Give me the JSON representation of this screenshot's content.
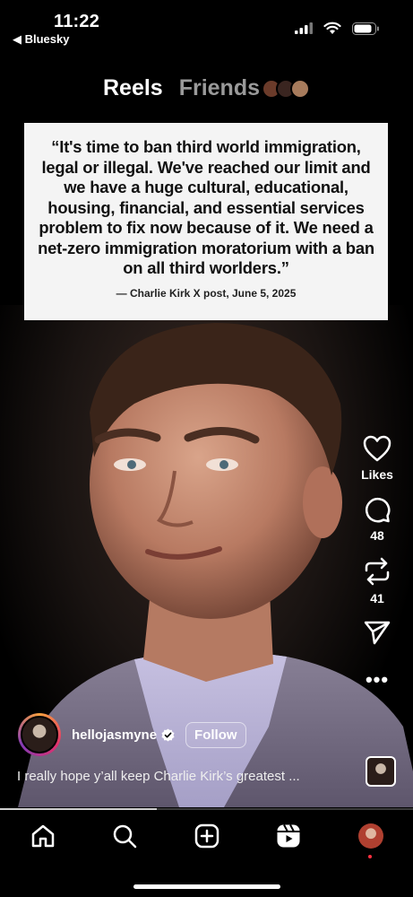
{
  "status": {
    "time": "11:22",
    "back_app": "◀ Bluesky"
  },
  "tabs": {
    "reels": "Reels",
    "friends": "Friends",
    "friend_avatar_colors": [
      "#6b3b2a",
      "#3a2520",
      "#a77b5c"
    ]
  },
  "post": {
    "quote": "“It's time to ban third world immigration, legal or illegal. We've reached our limit and we have a huge cultural, educational, housing, financial, and essential services problem to fix now because of it. We need a net-zero immigration moratorium with a ban on all third worlders.”",
    "attribution": "— Charlie Kirk X post, June 5, 2025",
    "owner": "hellojasmyne",
    "verified": true,
    "follow_label": "Follow",
    "caption": "I really hope y’all keep Charlie Kirk’s greatest ...",
    "progress": 0.38
  },
  "actions": {
    "likes_label": "Likes",
    "comments_count": "48",
    "reposts_count": "41"
  },
  "icons": {
    "like": "heart-icon",
    "comment": "comment-icon",
    "repost": "repost-icon",
    "share": "send-icon",
    "more": "more-icon",
    "nav": [
      "home-icon",
      "search-icon",
      "create-icon",
      "reels-icon",
      "profile-avatar"
    ]
  }
}
